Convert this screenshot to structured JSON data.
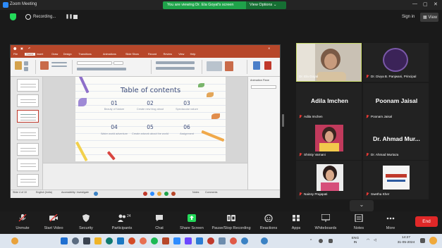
{
  "window": {
    "title": "Zoom Meeting",
    "min": "—",
    "max": "▢",
    "close": "✕"
  },
  "share_banner": {
    "viewing_text": "You are viewing Dr. Ela Goyal's screen",
    "view_options": "View Options ⌄"
  },
  "header": {
    "recording": "Recording...",
    "sign_in": "Sign in",
    "view": "View"
  },
  "slide": {
    "title": "Table of contents",
    "sections": [
      {
        "num": "01",
        "text": "Beauty of Nature"
      },
      {
        "num": "02",
        "text": "Create new blog about"
      },
      {
        "num": "03",
        "text": "Spectacular nature"
      },
      {
        "num": "04",
        "text": "Water world adventure"
      },
      {
        "num": "05",
        "text": "Create artwork about the world"
      },
      {
        "num": "06",
        "text": "Assignment"
      }
    ]
  },
  "ppt": {
    "tabs": [
      "File",
      "Home",
      "Insert",
      "Draw",
      "Design",
      "Transitions",
      "Animations",
      "Slide Show",
      "Record",
      "Review",
      "View",
      "Help"
    ],
    "side_pane": "Animation Pane",
    "status": [
      "Slide 4 of 10",
      "English (India)",
      "Accessibility: Investigate",
      "Notes",
      "Comments"
    ]
  },
  "participants": [
    {
      "name": "Dr. Ela Goyal",
      "type": "video",
      "muted": false,
      "active": true
    },
    {
      "name": "Dr. Divya B. Panjwani, Principal",
      "type": "logo",
      "muted": true
    },
    {
      "name": "Adila Imchen",
      "type": "text",
      "muted": true
    },
    {
      "name": "Poonam Jaisal",
      "type": "text",
      "muted": true
    },
    {
      "name": "Shristy Varnani",
      "type": "photo",
      "muted": true
    },
    {
      "name": "Dr. Ahmad Mur...",
      "label": "Dr. Ahmad Murtaza",
      "type": "text",
      "muted": true
    },
    {
      "name": "Nainsy Prajapati",
      "type": "photo",
      "muted": true
    },
    {
      "name": "Swetha Kher",
      "type": "logo",
      "muted": true
    }
  ],
  "toolbar": {
    "unmute": "Unmute",
    "start_video": "Start Video",
    "security": "Security",
    "participants": "Participants",
    "participants_count": "24",
    "chat": "Chat",
    "share_screen": "Share Screen",
    "pause_recording": "Pause/Stop Recording",
    "reactions": "Reactions",
    "apps": "Apps",
    "whiteboards": "Whiteboards",
    "notes": "Notes",
    "more": "More",
    "end": "End"
  },
  "taskbar": {
    "lang": "ENG IN",
    "time": "14:27",
    "date": "31-05-2024"
  },
  "colors": {
    "green_banner": "#1fa34a",
    "end_red": "#e02828",
    "ppt_red": "#b7472a",
    "active_border": "#c7d96a",
    "share_green": "#23d959"
  }
}
